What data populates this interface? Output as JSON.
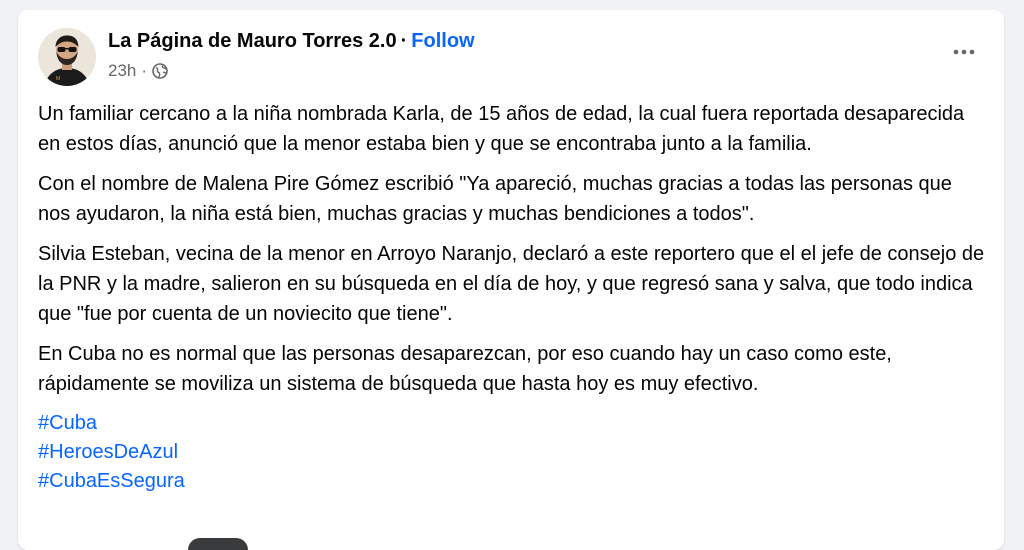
{
  "post": {
    "page_name": "La Página de Mauro Torres 2.0",
    "separator": "·",
    "follow_label": "Follow",
    "time": "23h",
    "time_separator": "·",
    "privacy_icon": "globe-icon",
    "more_icon": "more-horizontal-icon",
    "paragraphs": [
      "Un familiar cercano a la niña nombrada Karla, de 15 años de edad, la cual fuera reportada desaparecida en estos días, anunció que la menor estaba bien y que se encontraba junto a la familia.",
      "Con el nombre de Malena Pire Gómez escribió \"Ya apareció, muchas gracias a todas las personas que nos ayudaron, la niña está bien, muchas gracias y muchas bendiciones a todos\".",
      "Silvia Esteban, vecina de la menor en Arroyo Naranjo, declaró a este reportero que el el jefe de consejo de la PNR y la madre, salieron en su búsqueda en el día de hoy, y que regresó sana y salva, que todo indica que \"fue por cuenta de un noviecito que tiene\".",
      "En Cuba no es normal que las personas desaparezcan, por eso cuando hay un caso como este, rápidamente se moviliza un sistema de búsqueda que hasta hoy es muy efectivo."
    ],
    "hashtags": [
      "#Cuba",
      "#HeroesDeAzul",
      "#CubaEsSegura"
    ]
  },
  "colors": {
    "link": "#0866ff",
    "text": "#050505",
    "secondary": "#65676b",
    "background": "#f0f2f5"
  }
}
